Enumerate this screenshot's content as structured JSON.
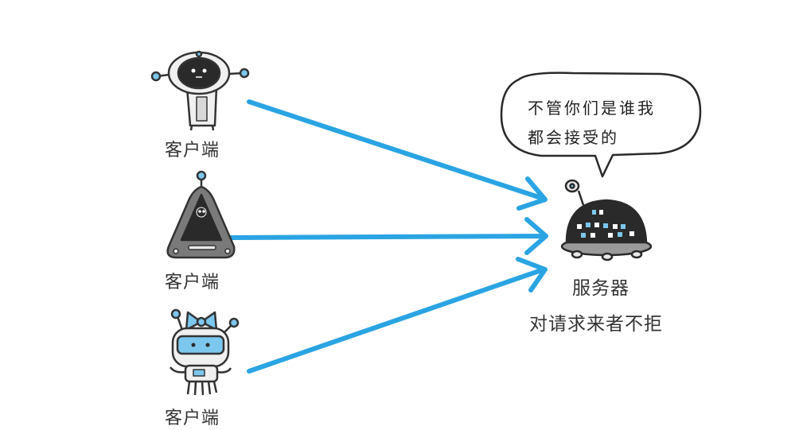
{
  "clients": [
    {
      "label": "客户端",
      "robot": "round-head-robot"
    },
    {
      "label": "客户端",
      "robot": "triangle-robot"
    },
    {
      "label": "客户端",
      "robot": "bow-robot"
    }
  ],
  "server": {
    "label": "服务器",
    "caption": "对请求来者不拒",
    "robot": "dome-robot"
  },
  "speech_bubble": {
    "lines": [
      "不管你们是谁我",
      "都会接受的"
    ]
  },
  "colors": {
    "arrow": "#2aa4e3",
    "outline": "#333333",
    "robot_fill": "#e8e8e8",
    "robot_dark": "#2a2a2a",
    "accent_blue": "#7cc7ee"
  }
}
